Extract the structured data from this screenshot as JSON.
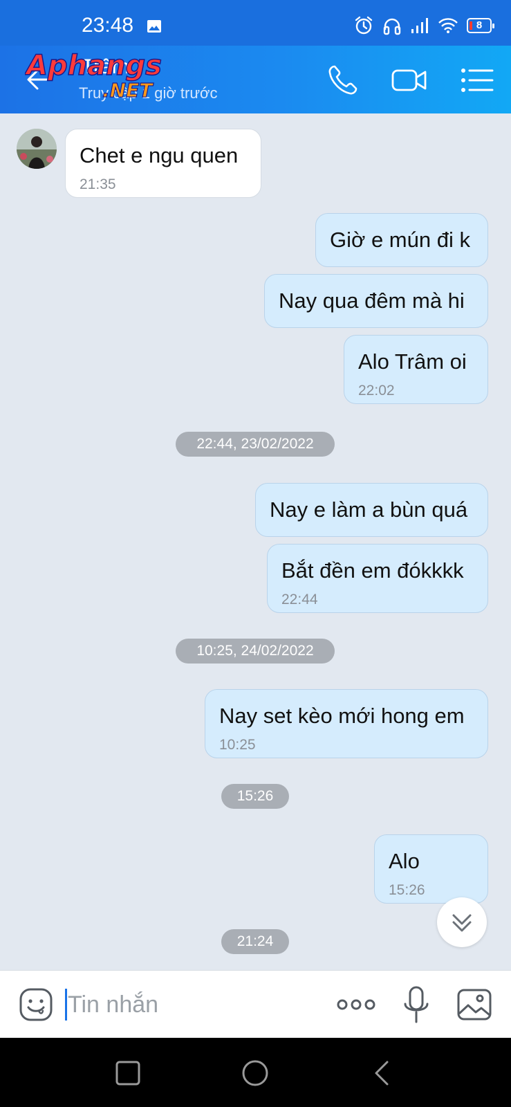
{
  "status_bar": {
    "time": "23:48",
    "battery": "8",
    "icons": [
      "photo-icon",
      "alarm-icon",
      "headphones-icon",
      "signal-icon",
      "wifi-icon",
      "battery-icon"
    ]
  },
  "header": {
    "contact_name": "Trâm",
    "contact_status": "Truy cập 1 giờ trước",
    "watermark_main": "Aphangs",
    "watermark_sub": ".NET",
    "icons": [
      "back-arrow-icon",
      "phone-icon",
      "video-camera-icon",
      "menu-list-icon"
    ]
  },
  "messages": [
    {
      "direction": "in",
      "text": "Chet e ngu quen",
      "time": "21:35"
    },
    {
      "direction": "out",
      "text": "Giờ e mún đi k",
      "time": ""
    },
    {
      "direction": "out",
      "text": "Nay qua đêm mà hi",
      "time": ""
    },
    {
      "direction": "out",
      "text": "Alo Trâm oi",
      "time": "22:02"
    },
    {
      "type": "date",
      "label": "22:44, 23/02/2022"
    },
    {
      "direction": "out",
      "text": "Nay e làm a bùn quá",
      "time": ""
    },
    {
      "direction": "out",
      "text": "Bắt đền em đókkkk",
      "time": "22:44"
    },
    {
      "type": "date",
      "label": "10:25, 24/02/2022"
    },
    {
      "direction": "out",
      "text": "Nay set kèo mới hong em",
      "time": "10:25"
    },
    {
      "type": "date",
      "label": "15:26"
    },
    {
      "direction": "out",
      "text": "Alo",
      "time": "15:26"
    },
    {
      "type": "date",
      "label": "21:24"
    }
  ],
  "input_bar": {
    "placeholder": "Tin nhắn",
    "value": "",
    "icons": [
      "emoji-icon",
      "more-options-icon",
      "microphone-icon",
      "image-icon"
    ]
  },
  "nav_bar": {
    "icons": [
      "recents-square-icon",
      "home-circle-icon",
      "back-triangle-icon"
    ]
  },
  "colors": {
    "header": "#1b8af0",
    "status_bar": "#1a6fde",
    "outgoing_bubble": "#d5ecfd",
    "incoming_bubble": "#ffffff",
    "chat_background": "#e2e8f0",
    "date_pill": "#a9aeb5"
  }
}
